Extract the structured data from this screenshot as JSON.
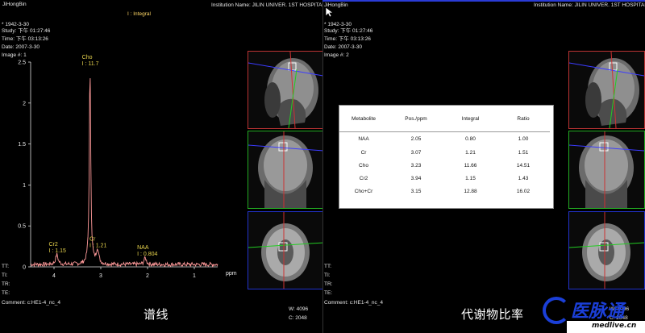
{
  "left": {
    "operator": "JiHongBin",
    "mode_label": "I : Integral",
    "institution": "Institution Name: JILIN UNIVER. 1ST HOSPITAL",
    "patient_id": "* 1942-3-30",
    "study": "Study: 下午 01:27:46",
    "time": "Time: 下午 03:13:26",
    "date": "Date: 2007-3-30",
    "image": "Image #: 1",
    "params": [
      "TT:",
      "TI:",
      "TR:",
      "TE:"
    ],
    "comment": "Comment: c:HE1-4_nc_4",
    "window_w": "W: 4096",
    "window_c": "C: 2048",
    "caption": "谱线"
  },
  "right": {
    "operator": "JiHongBin",
    "institution": "Institution Name: JILIN UNIVER. 1ST HOSPITAL",
    "patient_id": "* 1942-3-30",
    "study": "Study: 下午 01:27:46",
    "time": "Time: 下午 03:13:26",
    "date": "Date: 2007-3-30",
    "image": "Image #: 2",
    "params": [
      "TT:",
      "TI:",
      "TR:",
      "TE:"
    ],
    "comment": "Comment: c:HE1-4_nc_4",
    "window_w": "W: 4096",
    "window_c": "C: 2048",
    "caption": "代谢物比率"
  },
  "table": {
    "headers": [
      "Metabolite",
      "Pos./ppm",
      "Integral",
      "Ratio"
    ],
    "rows": [
      [
        "NAA",
        "2.05",
        "0.80",
        "1.00"
      ],
      [
        "Cr",
        "3.07",
        "1.21",
        "1.51"
      ],
      [
        "Cho",
        "3.23",
        "11.66",
        "14.51"
      ],
      [
        "Cr2",
        "3.94",
        "1.15",
        "1.43"
      ],
      [
        "Cho+Cr",
        "3.15",
        "12.88",
        "16.02"
      ]
    ]
  },
  "logo": {
    "brand": "医脉通",
    "url": "medlive.cn"
  },
  "chart_data": {
    "type": "line",
    "title": "",
    "xlabel": "ppm",
    "ylabel": "",
    "xlim": [
      4.5,
      0.5
    ],
    "ylim": [
      0,
      2.5
    ],
    "x_ticks": [
      "4",
      "3",
      "2",
      "1"
    ],
    "y_ticks": [
      "0",
      "0.5",
      "1",
      "1.5",
      "2",
      "2.5"
    ],
    "peaks": [
      {
        "name": "Cho",
        "pos": 3.23,
        "label": "Cho",
        "value_label": "I : 11.7",
        "height": 2.42
      },
      {
        "name": "Cr",
        "pos": 3.07,
        "label": "Cr",
        "value_label": "I : 1.21",
        "height": 0.18
      },
      {
        "name": "Cr2",
        "pos": 3.94,
        "label": "Cr2",
        "value_label": "I : 1.15",
        "height": 0.12
      },
      {
        "name": "NAA",
        "pos": 2.05,
        "label": "NAA",
        "value_label": "I : 0.804",
        "height": 0.08
      }
    ]
  }
}
